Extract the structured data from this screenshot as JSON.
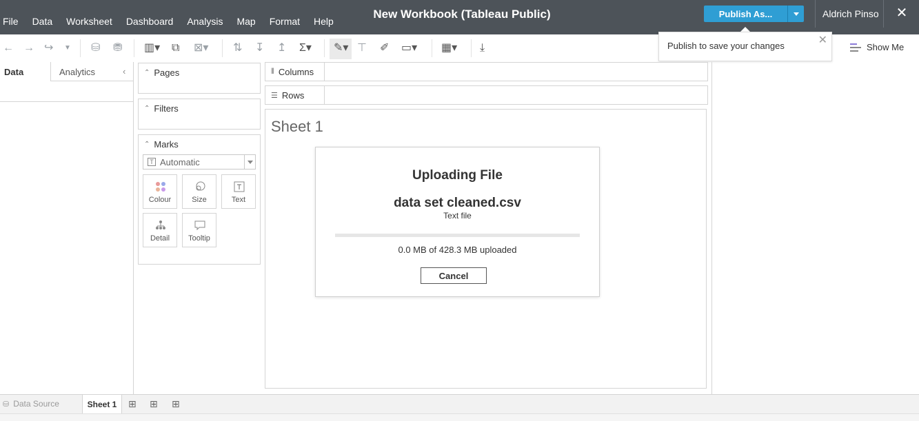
{
  "menu": [
    "File",
    "Data",
    "Worksheet",
    "Dashboard",
    "Analysis",
    "Map",
    "Format",
    "Help"
  ],
  "workbook_title": "New Workbook (Tableau Public)",
  "publish": {
    "label": "Publish As...",
    "popover_text": "Publish to save your changes"
  },
  "user": {
    "name": "Aldrich Pinso"
  },
  "toolbar": {
    "show_me_label": "Show Me"
  },
  "left_pane": {
    "data_tab": "Data",
    "analytics_tab": "Analytics"
  },
  "cards": {
    "pages_title": "Pages",
    "filters_title": "Filters",
    "marks_title": "Marks",
    "marks_type": "Automatic",
    "mark_buttons": [
      "Colour",
      "Size",
      "Text",
      "Detail",
      "Tooltip"
    ]
  },
  "shelves": {
    "columns": "Columns",
    "rows": "Rows"
  },
  "sheet": {
    "title": "Sheet 1"
  },
  "upload_dialog": {
    "title": "Uploading File",
    "file_name": "data set cleaned.csv",
    "file_type": "Text file",
    "progress_text": "0.0 MB of 428.3 MB uploaded",
    "progress_fraction": 0.0,
    "cancel_label": "Cancel"
  },
  "bottom_tabs": {
    "data_source": "Data Source",
    "sheet_tab": "Sheet 1"
  },
  "colors": {
    "topbar": "#4d5359",
    "accent": "#2f9ed4"
  }
}
